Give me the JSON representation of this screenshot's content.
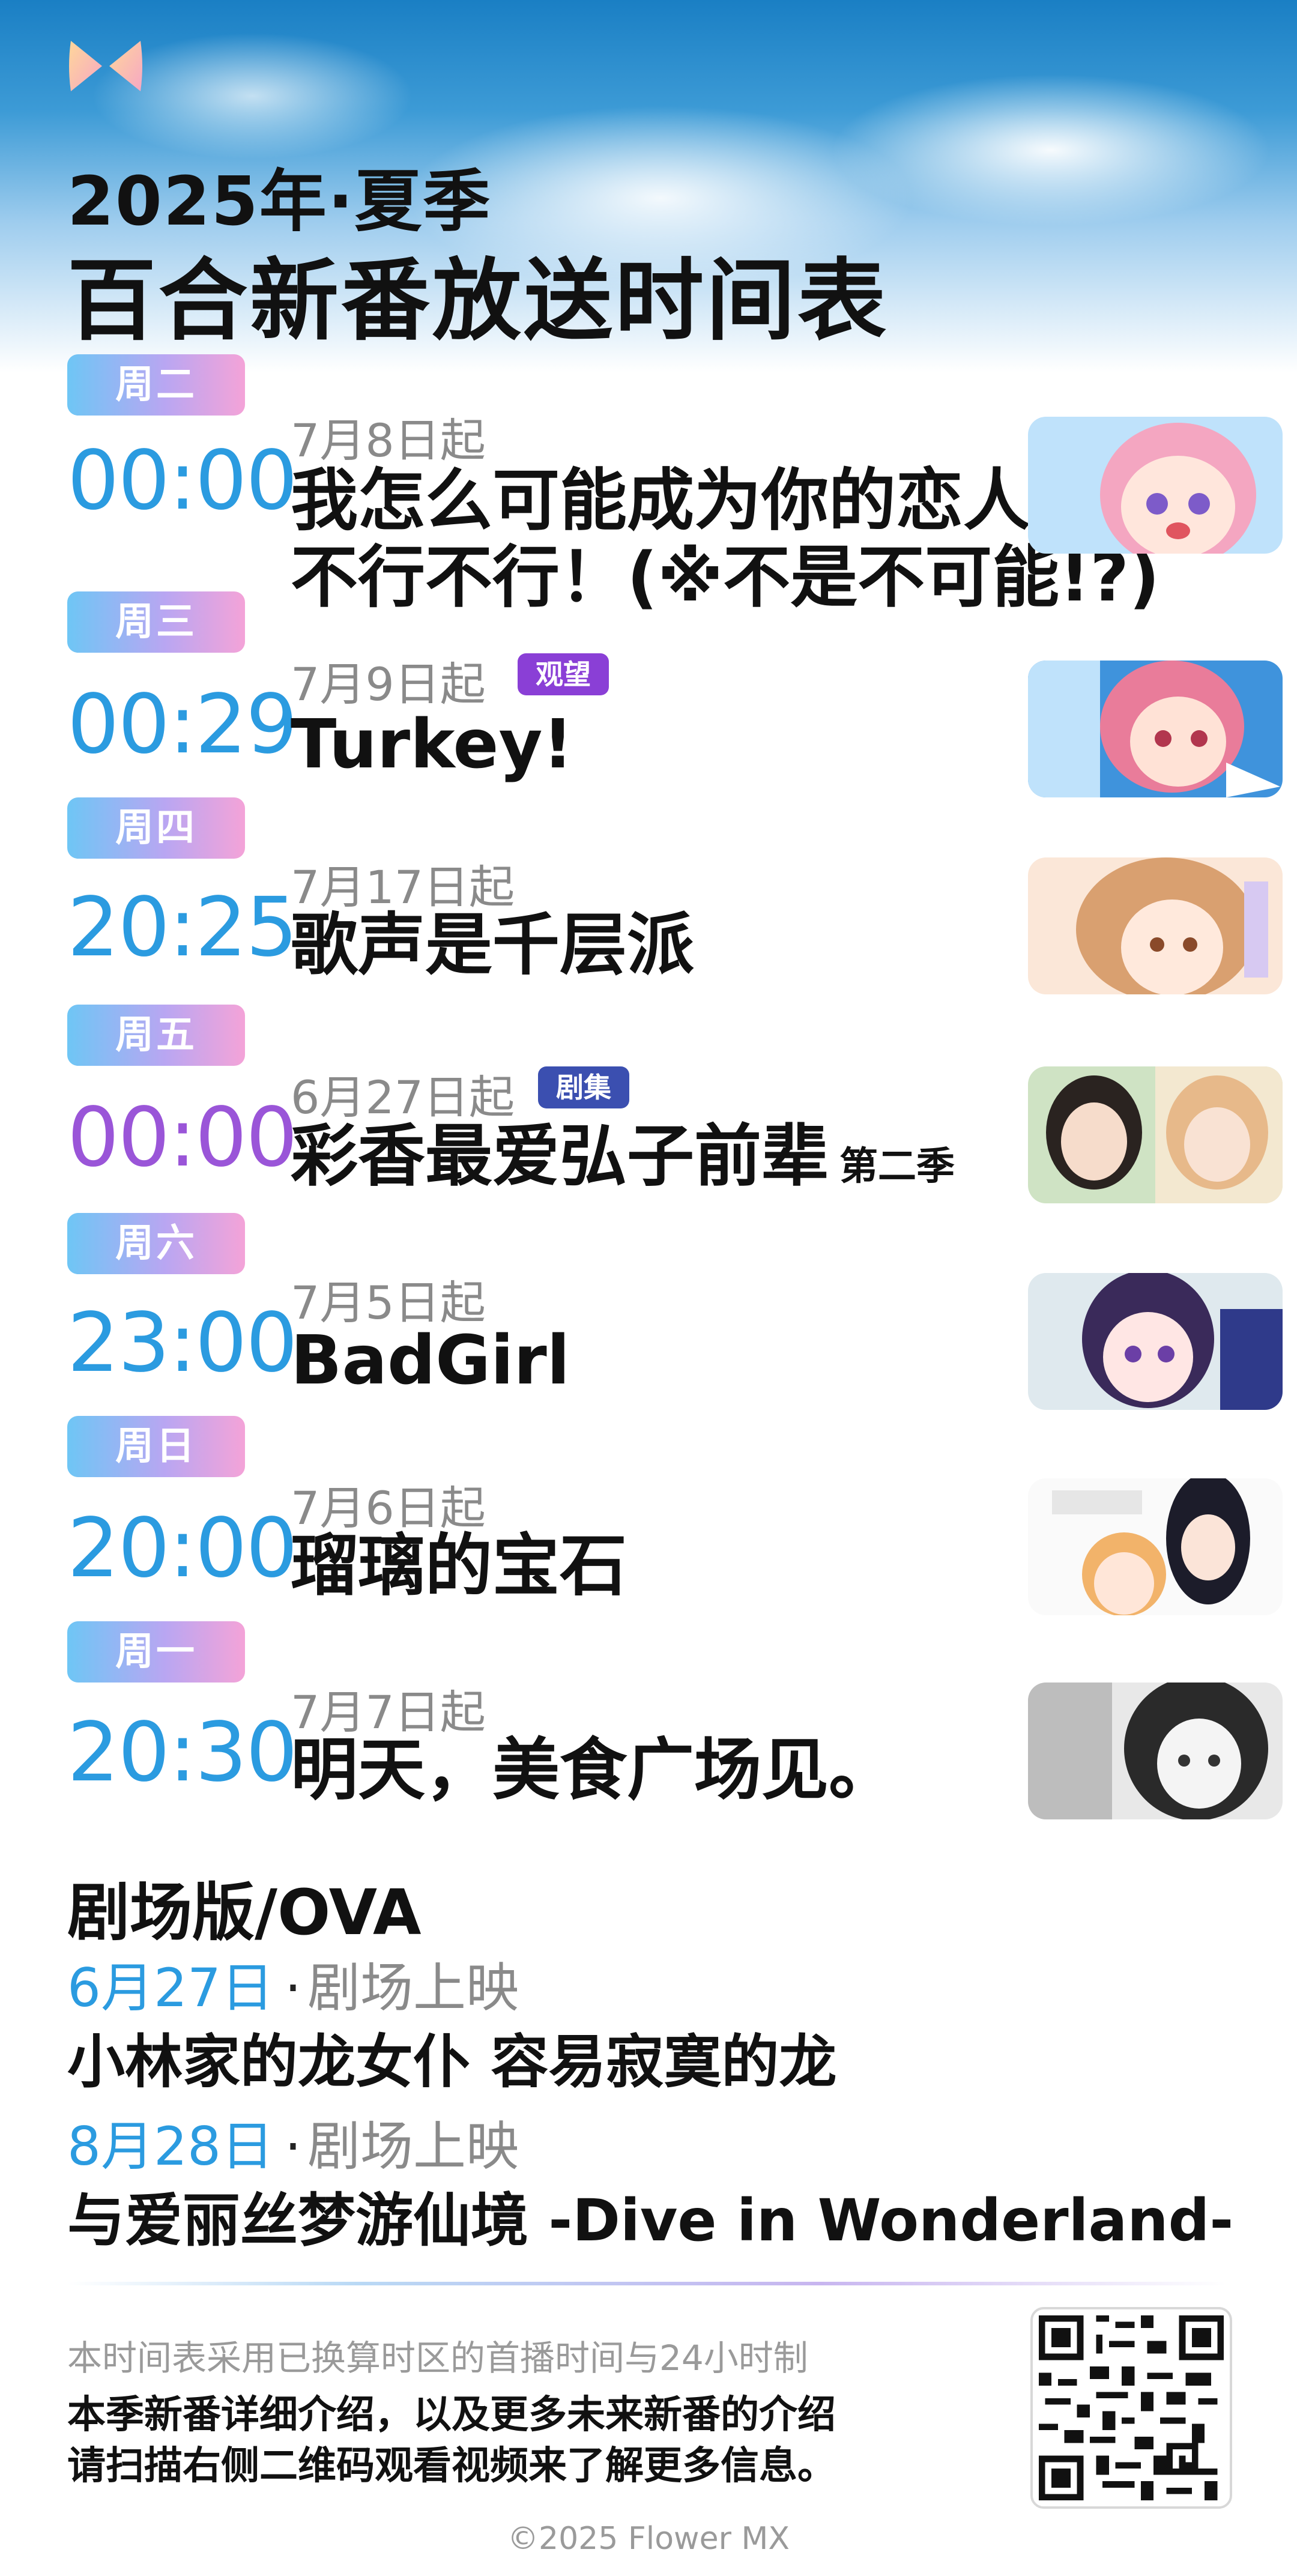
{
  "header": {
    "year_season": "2025年·夏季",
    "title": "百合新番放送时间表"
  },
  "schedule": [
    {
      "day": "周二",
      "time": "00:00",
      "start": "7月8日起",
      "title": "我怎么可能成为你的恋人，",
      "title_line2": "不行不行！(※不是不可能!?)",
      "badge": "",
      "subtitle": ""
    },
    {
      "day": "周三",
      "time": "00:29",
      "start": "7月9日起",
      "title": "Turkey!",
      "badge": "观望",
      "subtitle": ""
    },
    {
      "day": "周四",
      "time": "20:25",
      "start": "7月17日起",
      "title": "歌声是千层派",
      "badge": "",
      "subtitle": ""
    },
    {
      "day": "周五",
      "time": "00:00",
      "start": "6月27日起",
      "title": "彩香最爱弘子前辈",
      "badge": "剧集",
      "subtitle": "第二季"
    },
    {
      "day": "周六",
      "time": "23:00",
      "start": "7月5日起",
      "title": "BadGirl",
      "badge": "",
      "subtitle": ""
    },
    {
      "day": "周日",
      "time": "20:00",
      "start": "7月6日起",
      "title": "瑠璃的宝石",
      "badge": "",
      "subtitle": ""
    },
    {
      "day": "周一",
      "time": "20:30",
      "start": "7月7日起",
      "title": "明天，美食广场见。",
      "badge": "",
      "subtitle": ""
    }
  ],
  "movies": {
    "section_title": "剧场版/OVA",
    "items": [
      {
        "date": "6月27日",
        "dot": "·",
        "kind": "剧场上映",
        "title": "小林家的龙女仆 容易寂寞的龙"
      },
      {
        "date": "8月28日",
        "dot": "·",
        "kind": "剧场上映",
        "title": "与爱丽丝梦游仙境 -Dive in Wonderland-"
      }
    ]
  },
  "footer": {
    "note1": "本时间表采用已换算时区的首播时间与24小时制",
    "note2": "本季新番详细介绍，以及更多未来新番的介绍",
    "note3": "请扫描右侧二维码观看视频来了解更多信息。",
    "copyright": "©2025 Flower MX"
  },
  "colors": {
    "time_blue": "#2b9be0",
    "time_purple": "#9a55d8",
    "badge_watch": "#8a3fd6",
    "badge_drama": "#3b4fb0"
  },
  "icons": {
    "logo": "bow-logo-icon",
    "qr": "qr-code-icon"
  }
}
